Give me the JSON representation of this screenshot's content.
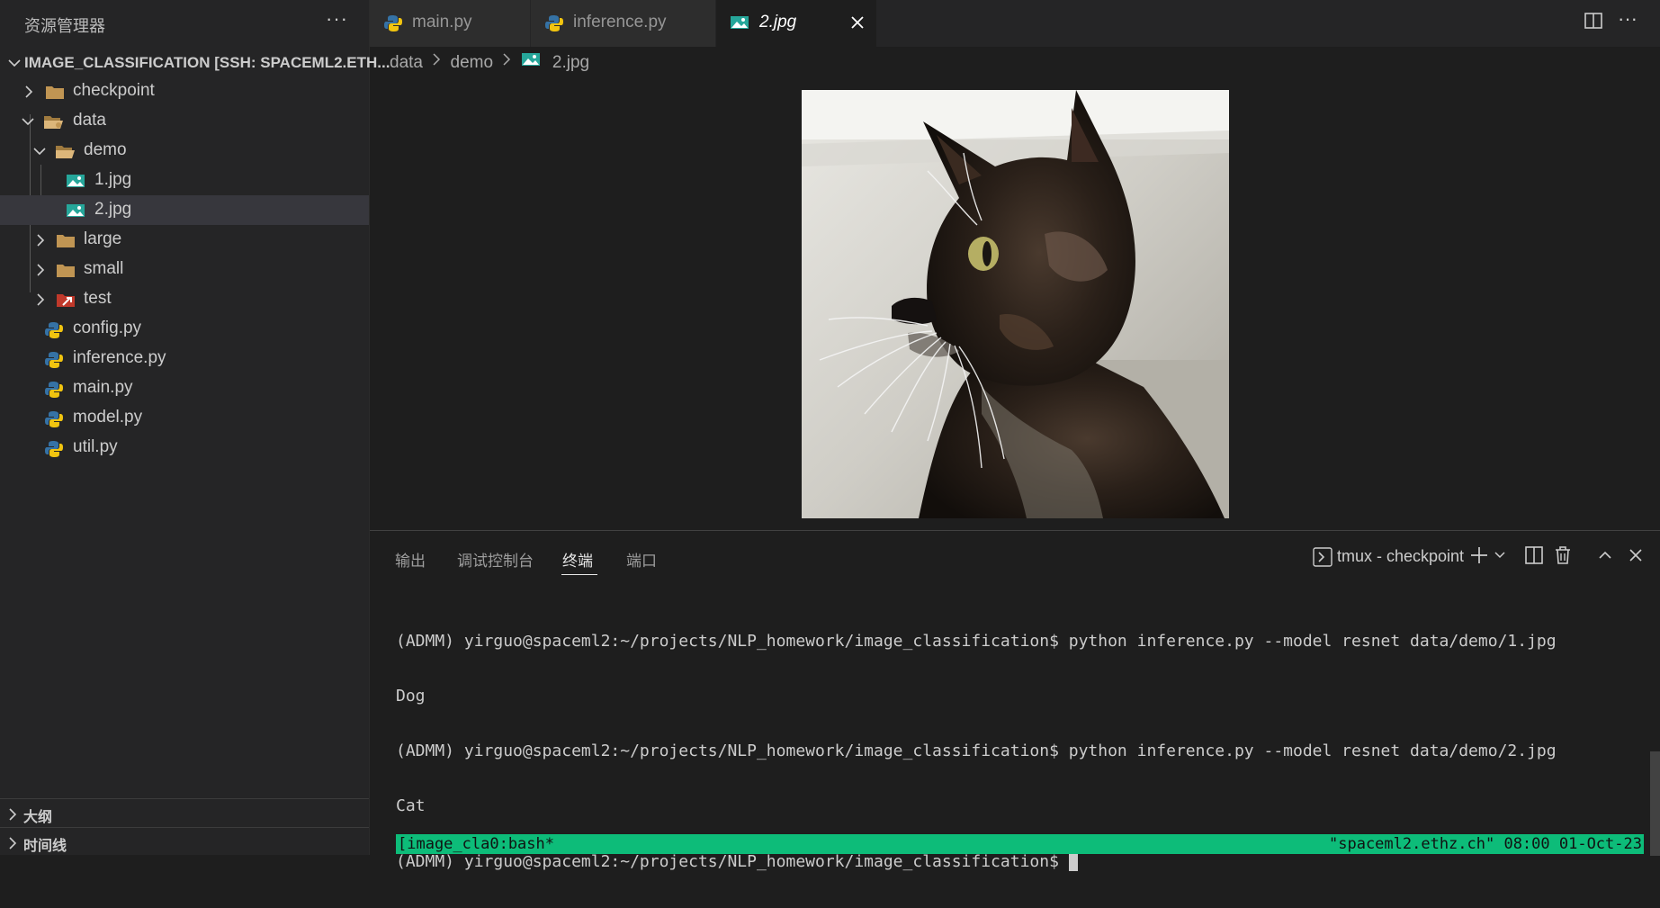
{
  "sidebar": {
    "title": "资源管理器",
    "more": "···",
    "root": "IMAGE_CLASSIFICATION [SSH: SPACEML2.ETH...",
    "items": [
      {
        "label": "checkpoint",
        "icon": "folder-icon",
        "expanded": false
      },
      {
        "label": "data",
        "icon": "folder-open-icon",
        "expanded": true
      },
      {
        "label": "demo",
        "icon": "folder-open-icon",
        "expanded": true
      },
      {
        "label": "1.jpg",
        "icon": "image-file-icon"
      },
      {
        "label": "2.jpg",
        "icon": "image-file-icon",
        "selected": true
      },
      {
        "label": "large",
        "icon": "folder-icon",
        "expanded": false
      },
      {
        "label": "small",
        "icon": "folder-icon",
        "expanded": false
      },
      {
        "label": "test",
        "icon": "test-folder-icon",
        "expanded": false
      },
      {
        "label": "config.py",
        "icon": "python-file-icon"
      },
      {
        "label": "inference.py",
        "icon": "python-file-icon"
      },
      {
        "label": "main.py",
        "icon": "python-file-icon"
      },
      {
        "label": "model.py",
        "icon": "python-file-icon"
      },
      {
        "label": "util.py",
        "icon": "python-file-icon"
      }
    ],
    "outline": "大纲",
    "timeline": "时间线"
  },
  "tabs": [
    {
      "label": "main.py",
      "icon": "python-file-icon"
    },
    {
      "label": "inference.py",
      "icon": "python-file-icon"
    },
    {
      "label": "2.jpg",
      "icon": "image-file-icon",
      "active": true
    }
  ],
  "editor": {
    "more": "···",
    "breadcrumb": [
      "data",
      "demo",
      "2.jpg"
    ]
  },
  "panel": {
    "tabs": [
      "输出",
      "调试控制台",
      "终端",
      "端口"
    ],
    "active_tab": "终端",
    "terminal_name": "tmux - checkpoint",
    "lines": [
      "(ADMM) yirguo@spaceml2:~/projects/NLP_homework/image_classification$ python inference.py --model resnet data/demo/1.jpg",
      "Dog",
      "(ADMM) yirguo@spaceml2:~/projects/NLP_homework/image_classification$ python inference.py --model resnet data/demo/2.jpg",
      "Cat",
      "(ADMM) yirguo@spaceml2:~/projects/NLP_homework/image_classification$ "
    ],
    "tmux_left": "[image_cla0:bash*",
    "tmux_right": "\"spaceml2.ethz.ch\" 08:00 01-Oct-23"
  },
  "colors": {
    "accent_green": "#0dbc79",
    "folder": "#c09553",
    "python_blue": "#3572a5",
    "python_yellow": "#f1c40f",
    "image_icon": "#26a69a"
  }
}
